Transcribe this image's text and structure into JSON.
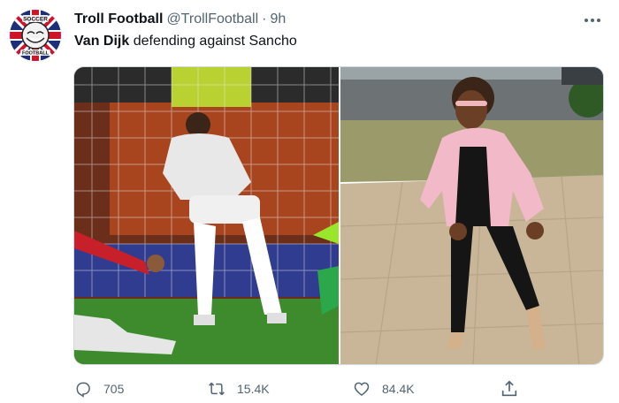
{
  "tweet": {
    "display_name": "Troll Football",
    "handle": "@TrollFootball",
    "separator": "·",
    "time": "9h",
    "text_bold": "Van Dijk",
    "text_rest": " defending against Sancho",
    "avatar_text_top": "SOCCER",
    "avatar_text_bottom": "FOOTBALL"
  },
  "actions": {
    "reply_count": "705",
    "retweet_count": "15.4K",
    "like_count": "84.4K"
  },
  "icons": {
    "more": "more-horizontal-icon",
    "reply": "reply-icon",
    "retweet": "retweet-icon",
    "like": "heart-icon",
    "share": "share-icon"
  },
  "colors": {
    "text_primary": "#0f1419",
    "text_secondary": "#536471",
    "border": "#cfd9de"
  }
}
